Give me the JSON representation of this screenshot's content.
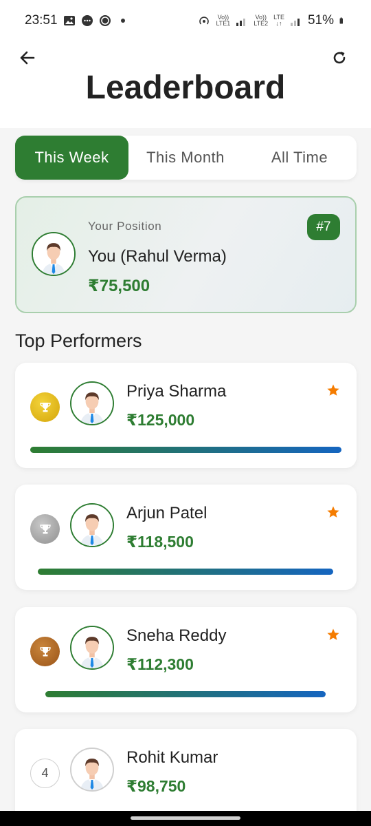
{
  "status_bar": {
    "time": "23:51",
    "battery": "51%",
    "lte1": "LTE1",
    "lte2": "LTE2",
    "lte": "LTE",
    "volte": "Vo))"
  },
  "header": {
    "title": "Leaderboard"
  },
  "tabs": [
    {
      "label": "This Week",
      "active": true
    },
    {
      "label": "This Month",
      "active": false
    },
    {
      "label": "All Time",
      "active": false
    }
  ],
  "your_position": {
    "label": "Your Position",
    "name": "You (Rahul Verma)",
    "amount": "₹75,500",
    "rank": "#7"
  },
  "section_title": "Top Performers",
  "performers": [
    {
      "name": "Priya Sharma",
      "amount": "₹125,000",
      "medal": "gold-trophy-icon",
      "progress": 1.0
    },
    {
      "name": "Arjun Patel",
      "amount": "₹118,500",
      "medal": "silver-trophy-icon",
      "progress": 0.948
    },
    {
      "name": "Sneha Reddy",
      "amount": "₹112,300",
      "medal": "bronze-trophy-icon",
      "progress": 0.898
    },
    {
      "name": "Rohit Kumar",
      "amount": "₹98,750",
      "rank": "4"
    }
  ],
  "colors": {
    "primary": "#2e7d32",
    "accent_blue": "#1565c0",
    "star": "#f57c00"
  }
}
